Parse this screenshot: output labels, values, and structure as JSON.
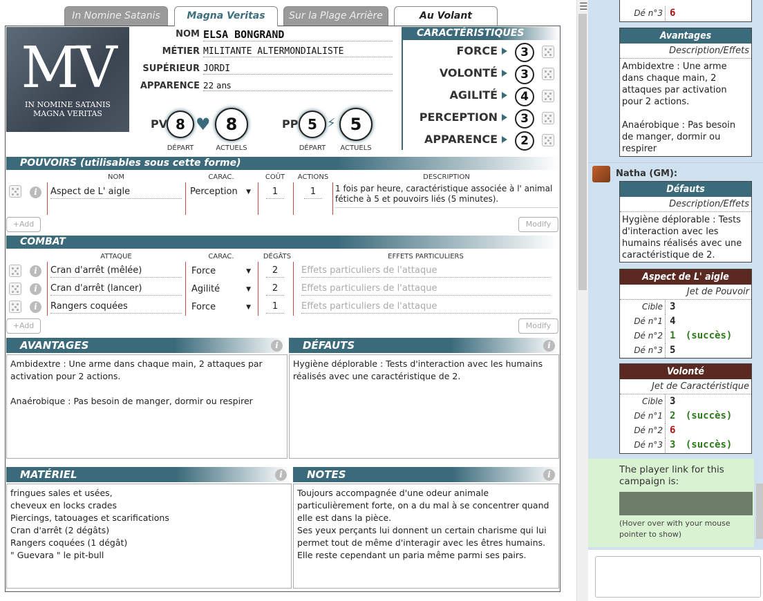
{
  "tabs": [
    "In Nomine Satanis",
    "Magna Veritas",
    "Sur la Plage Arrière",
    "Au Volant"
  ],
  "logo": {
    "big": "MV",
    "line1": "IN NOMINE SATANIS",
    "line2": "MAGNA VERITAS"
  },
  "identity": {
    "nom_label": "NOM",
    "nom": "ELSA BONGRAND",
    "metier_label": "MÉTIER",
    "metier": "MILITANTE ALTERMONDIALISTE",
    "superieur_label": "SUPÉRIEUR",
    "superieur": "JORDI",
    "apparence_label": "APPARENCE",
    "apparence": "22 ans"
  },
  "pv": {
    "label": "PV",
    "depart": "8",
    "actuels": "8",
    "depart_label": "DÉPART",
    "actuels_label": "ACTUELS"
  },
  "pp": {
    "label": "PP",
    "depart": "5",
    "actuels": "5",
    "depart_label": "DÉPART",
    "actuels_label": "ACTUELS"
  },
  "caracteristiques": {
    "title": "CARACTÉRISTIQUES",
    "items": [
      {
        "label": "FORCE",
        "value": "3"
      },
      {
        "label": "VOLONTÉ",
        "value": "3"
      },
      {
        "label": "AGILITÉ",
        "value": "4"
      },
      {
        "label": "PERCEPTION",
        "value": "3"
      },
      {
        "label": "APPARENCE",
        "value": "2"
      }
    ]
  },
  "pouvoirs": {
    "title": "POUVOIRS (utilisables sous cette forme)",
    "headers": {
      "nom": "NOM",
      "carac": "CARAC.",
      "cout": "COÛT",
      "actions": "ACTIONS",
      "description": "DESCRIPTION"
    },
    "rows": [
      {
        "nom": "Aspect de L' aigle",
        "carac": "Perception",
        "cout": "1",
        "actions": "1",
        "description": "1 fois par heure, caractéristique associée à l' animal fétiche à 5 et pouvoirs liés (5 minutes)."
      }
    ],
    "add": "+Add",
    "modify": "Modify"
  },
  "combat": {
    "title": "COMBAT",
    "headers": {
      "attaque": "ATTAQUE",
      "carac": "CARAC.",
      "degats": "DÉGÂTS",
      "effets": "EFFETS PARTICULIERS"
    },
    "effets_placeholder": "Effets particuliers de l'attaque",
    "rows": [
      {
        "attaque": "Cran d'arrêt (mêlée)",
        "carac": "Force",
        "degats": "2"
      },
      {
        "attaque": "Cran d'arrêt (lancer)",
        "carac": "Agilité",
        "degats": "2"
      },
      {
        "attaque": "Rangers coquées",
        "carac": "Force",
        "degats": "1"
      }
    ],
    "add": "+Add",
    "modify": "Modify"
  },
  "avantages": {
    "title": "AVANTAGES",
    "text": "Ambidextre : Une arme dans chaque main, 2 attaques par activation pour 2 actions.\n\nAnaérobique : Pas besoin de manger, dormir ou respirer"
  },
  "defauts": {
    "title": "DÉFAUTS",
    "text": "Hygiène déplorable : Tests d'interaction avec les humains réalisés avec une caractéristique de 2."
  },
  "materiel": {
    "title": "MATÉRIEL",
    "text": "fringues sales et usées,\ncheveux en locks crades\nPiercings, tatouages et scarifications\nCran d'arrêt (2 dégâts)\nRangers coquées (1 dégât)\n\" Guevara \" le pit-bull"
  },
  "notes": {
    "title": "NOTES",
    "text": "Toujours accompagnée d'une odeur animale particulièrement forte, on a du mal à se concentrer quand elle est dans la pièce.\nSes yeux perçants lui donnent un certain charisme qui lui permet tout de même d'interagir avec les êtres humains.\nElle reste cependant un paria même parmi ses pairs."
  },
  "chat": {
    "top_roll": {
      "k": "Dé n°3",
      "v": "6"
    },
    "avantages_card": {
      "title": "Avantages",
      "sub": "Description/Effets",
      "body": "Ambidextre : Une arme dans chaque main, 2 attaques par activation pour 2 actions.\n\nAnaérobique : Pas besoin de manger, dormir ou respirer"
    },
    "sender": "Natha (GM):",
    "defauts_card": {
      "title": "Défauts",
      "sub": "Description/Effets",
      "body": "Hygiène déplorable : Tests d'interaction avec les humains réalisés avec une caractéristique de 2."
    },
    "pouvoir_card": {
      "title": "Aspect de L' aigle",
      "sub": "Jet de Pouvoir",
      "rows": [
        {
          "k": "Cible",
          "v": "3",
          "s": ""
        },
        {
          "k": "Dé n°1",
          "v": "4",
          "s": ""
        },
        {
          "k": "Dé n°2",
          "v": "1",
          "s": "(succès)"
        },
        {
          "k": "Dé n°3",
          "v": "5",
          "s": ""
        }
      ]
    },
    "volonte_card": {
      "title": "Volonté",
      "sub": "Jet de Caractéristique",
      "rows": [
        {
          "k": "Cible",
          "v": "3",
          "s": ""
        },
        {
          "k": "Dé n°1",
          "v": "2",
          "s": "(succès)"
        },
        {
          "k": "Dé n°2",
          "v": "6",
          "s": ""
        },
        {
          "k": "Dé n°3",
          "v": "3",
          "s": "(succès)"
        }
      ]
    },
    "player_link": {
      "text": "The player link for this campaign is:",
      "hint": "(Hover over with your mouse pointer to show)"
    }
  }
}
